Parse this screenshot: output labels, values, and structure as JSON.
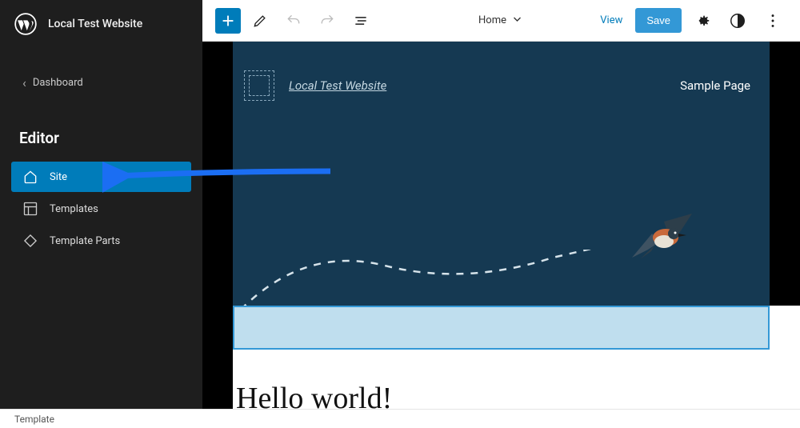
{
  "site": {
    "name": "Local Test Website"
  },
  "sidebar": {
    "back_label": "Dashboard",
    "section_title": "Editor",
    "items": [
      {
        "label": "Site",
        "icon": "home"
      },
      {
        "label": "Templates",
        "icon": "layout"
      },
      {
        "label": "Template Parts",
        "icon": "diamond"
      }
    ]
  },
  "toolbar": {
    "document_name": "Home",
    "view_label": "View",
    "save_label": "Save"
  },
  "preview": {
    "site_link": "Local Test Website",
    "nav_link": "Sample Page",
    "post_title": "Hello world!"
  },
  "status": {
    "breadcrumb": "Template"
  },
  "colors": {
    "accent": "#007cba",
    "sidebar_bg": "#1e1e1e",
    "hero_bg": "#153952",
    "annotation": "#1b6ef3"
  }
}
